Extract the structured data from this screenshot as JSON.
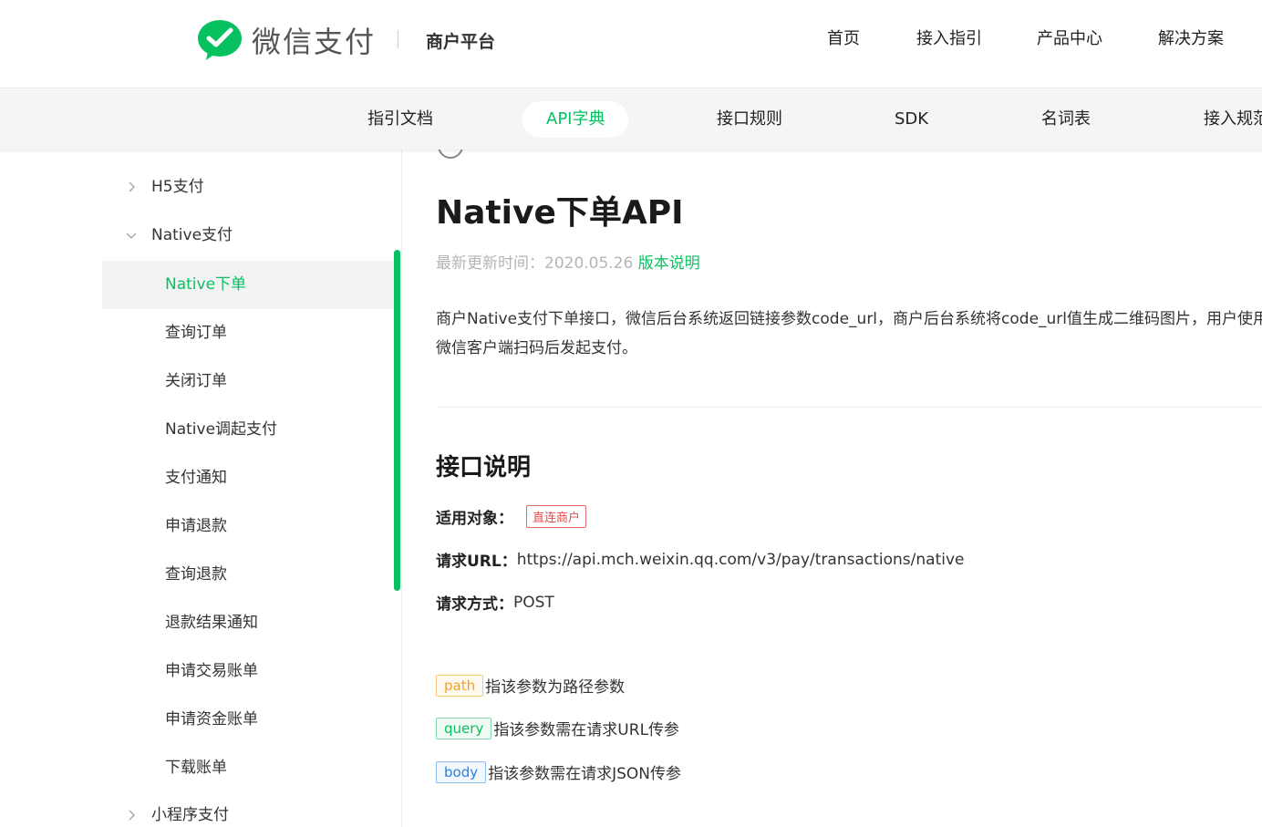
{
  "header": {
    "logo_text": "微信支付",
    "platform": "商户平台",
    "nav": [
      "首页",
      "接入指引",
      "产品中心",
      "解决方案"
    ]
  },
  "subnav": {
    "items": [
      "指引文档",
      "API字典",
      "接口规则",
      "SDK",
      "名词表",
      "接入规范"
    ],
    "active": "API字典"
  },
  "sidebar": {
    "items": [
      {
        "label": "H5支付",
        "level": 1,
        "state": "collapsed"
      },
      {
        "label": "Native支付",
        "level": 1,
        "state": "expanded"
      },
      {
        "label": "Native下单",
        "level": 2,
        "active": true
      },
      {
        "label": "查询订单",
        "level": 2
      },
      {
        "label": "关闭订单",
        "level": 2
      },
      {
        "label": "Native调起支付",
        "level": 2
      },
      {
        "label": "支付通知",
        "level": 2
      },
      {
        "label": "申请退款",
        "level": 2
      },
      {
        "label": "查询退款",
        "level": 2
      },
      {
        "label": "退款结果通知",
        "level": 2
      },
      {
        "label": "申请交易账单",
        "level": 2
      },
      {
        "label": "申请资金账单",
        "level": 2
      },
      {
        "label": "下载账单",
        "level": 2
      },
      {
        "label": "小程序支付",
        "level": 1,
        "state": "collapsed"
      }
    ]
  },
  "content": {
    "title": "Native下单API",
    "updated_label": "最新更新时间：",
    "updated_date": "2020.05.26",
    "version_link": "版本说明",
    "description": "商户Native支付下单接口，微信后台系统返回链接参数code_url，商户后台系统将code_url值生成二维码图片，用户使用微信客户端扫码后发起支付。",
    "section_title": "接口说明",
    "applicable_label": "适用对象：",
    "applicable_value": "直连商户",
    "url_label": "请求URL：",
    "url_value": "https://api.mch.weixin.qq.com/v3/pay/transactions/native",
    "method_label": "请求方式：",
    "method_value": "POST",
    "params": [
      {
        "tag": "path",
        "text": "指该参数为路径参数"
      },
      {
        "tag": "query",
        "text": "指该参数需在请求URL传参"
      },
      {
        "tag": "body",
        "text": "指该参数需在请求JSON传参"
      }
    ]
  },
  "colors": {
    "brand": "#07c160",
    "badge_red": "#e14d4d",
    "path": "#f0a020",
    "body": "#2a7fd9"
  }
}
